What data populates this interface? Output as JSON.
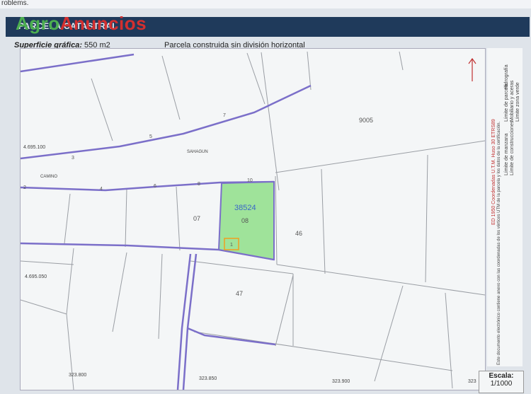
{
  "top_text": "roblems.",
  "header": {
    "title": "PARCELA CATASTRAL"
  },
  "brand": {
    "part1": "Agro",
    "part2": "Anuncios"
  },
  "info": {
    "surface_label": "Superficie gráfica:",
    "surface_value": "550 m2",
    "description": "Parcela construida sin división horizontal"
  },
  "map": {
    "coord_y_top": "4.695.100",
    "coord_y_bottom": "4.695.050",
    "coord_x_1": "323.800",
    "coord_x_2": "323.850",
    "coord_x_3": "323.900",
    "coord_x_4": "323",
    "street_1": "SAHAGUN",
    "street_2": "CAMINO",
    "parcel_ref": "38524",
    "labels": [
      "9005",
      "07",
      "08",
      "46",
      "47"
    ],
    "vertex_labels": [
      "7",
      "5",
      "3",
      "2",
      "4",
      "6",
      "8",
      "10",
      "1"
    ],
    "colors": {
      "parcel_fill": "#9fe39a",
      "lines": "#7b6fc9",
      "building": "#f0a020"
    }
  },
  "legend": {
    "items": [
      "Límite de manzana",
      "Límite de parcela",
      "Límite de construcciones",
      "Mobiliario y aceras",
      "Límite zona verde",
      "Hidrografía"
    ],
    "note_1": "ED 1950 Coordenadas U.T.M. Huso 30 ETRS89",
    "note_2": "Este documento electrónico contiene anexo con las coordenadas de los vértices UTM de la parcela y los datos de la certificación."
  },
  "scale": {
    "label": "Escala:",
    "value": "1/1000"
  }
}
